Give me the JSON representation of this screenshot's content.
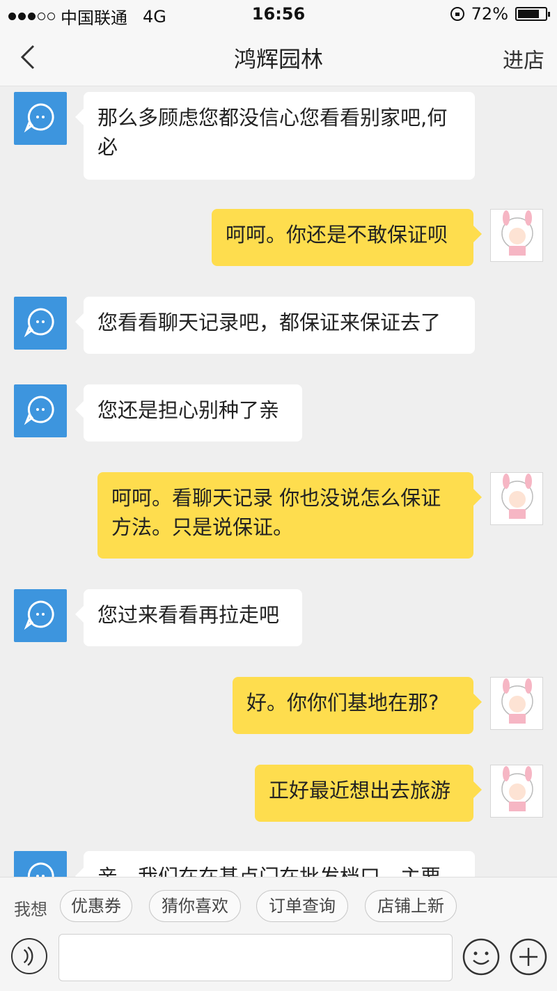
{
  "status_bar": {
    "carrier": "中国联通",
    "network": "4G",
    "time": "16:56",
    "battery": "72%"
  },
  "header": {
    "title": "鸿辉园林",
    "right_action": "进店"
  },
  "messages": [
    {
      "from": "shop",
      "text": "那么多顾虑您都没信心您看看别家吧,何必"
    },
    {
      "from": "user",
      "text": "呵呵。你还是不敢保证呗"
    },
    {
      "from": "shop",
      "text": "您看看聊天记录吧，都保证来保证去了"
    },
    {
      "from": "shop",
      "text": "您还是担心别种了亲"
    },
    {
      "from": "user",
      "text": "呵呵。看聊天记录 你也没说怎么保证方法。只是说保证。"
    },
    {
      "from": "shop",
      "text": "您过来看看再拉走吧"
    },
    {
      "from": "user",
      "text": "好。你你们基地在那?"
    },
    {
      "from": "user",
      "text": "正好最近想出去旅游"
    },
    {
      "from": "shop",
      "text": "亲，我们在在基点门在批发档口，主要"
    }
  ],
  "quick_bar": {
    "label": "我想",
    "chips": [
      "优惠券",
      "猜你喜欢",
      "订单查询",
      "店铺上新"
    ]
  },
  "input_bar": {
    "placeholder": ""
  },
  "colors": {
    "shop_avatar": "#3d95de",
    "outgoing_bubble": "#fedd4e",
    "incoming_bubble": "#ffffff",
    "background": "#efefef"
  }
}
